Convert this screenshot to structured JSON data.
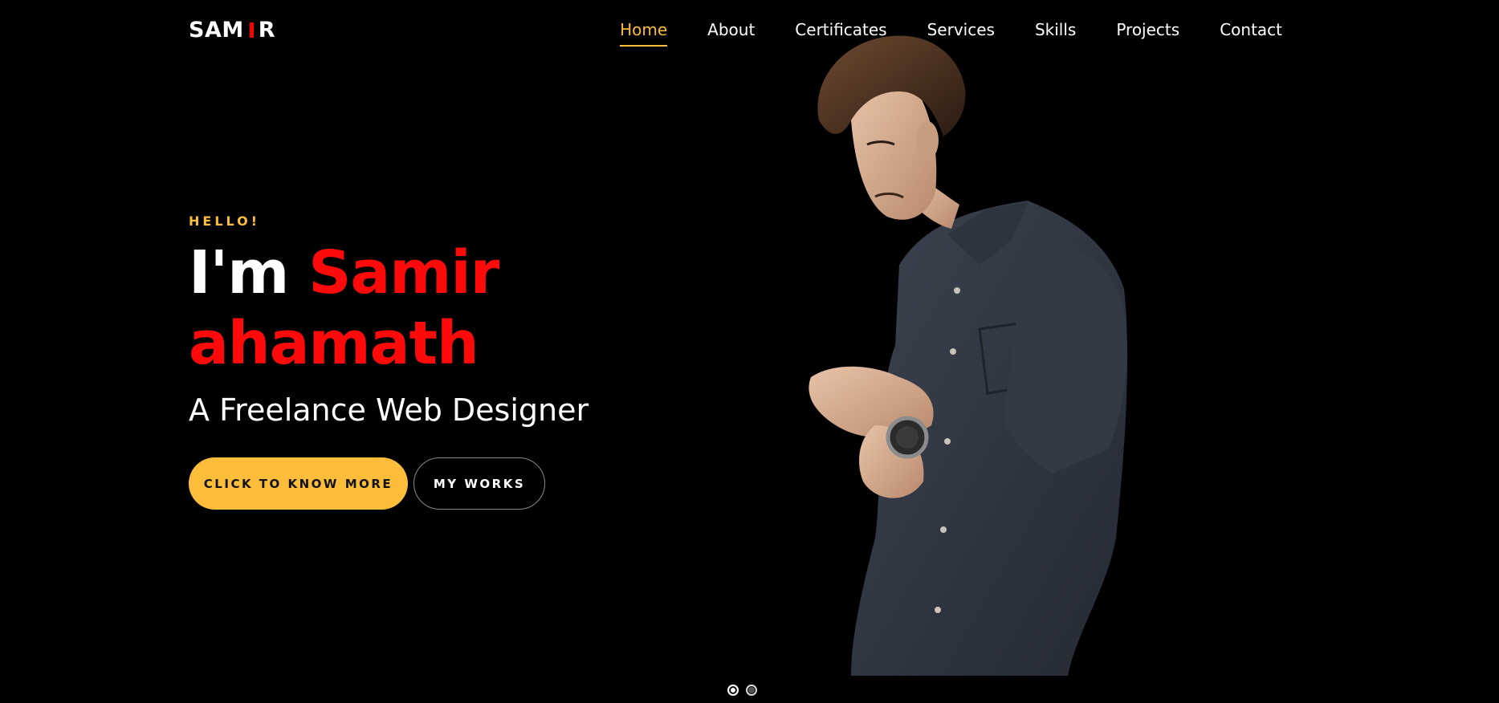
{
  "brand": {
    "logo_left": "SAM",
    "logo_right": "R"
  },
  "nav": {
    "items": [
      {
        "label": "Home",
        "active": true
      },
      {
        "label": "About",
        "active": false
      },
      {
        "label": "Certificates",
        "active": false
      },
      {
        "label": "Services",
        "active": false
      },
      {
        "label": "Skills",
        "active": false
      },
      {
        "label": "Projects",
        "active": false
      },
      {
        "label": "Contact",
        "active": false
      }
    ]
  },
  "hero": {
    "greeting": "HELLO!",
    "intro": "I'm",
    "first_name": "Samir",
    "last_name": "ahamath",
    "subtitle": "A Freelance Web Designer",
    "primary_button": "CLICK TO KNOW MORE",
    "secondary_button": "MY WORKS"
  },
  "slider": {
    "total": 2,
    "active_index": 0
  },
  "colors": {
    "background": "#000000",
    "accent_yellow": "#fbbd3a",
    "accent_red": "#ff0a0a",
    "text": "#ffffff"
  }
}
